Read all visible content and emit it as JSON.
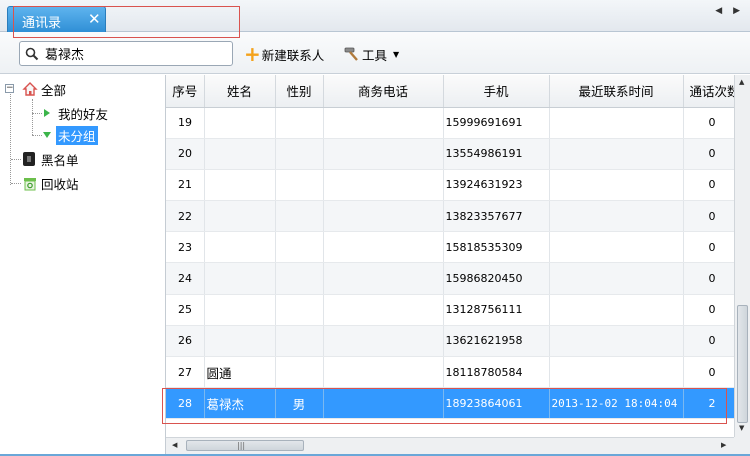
{
  "tab": {
    "title": "通讯录",
    "close": "✕"
  },
  "nav": {
    "arrows": "◀ ▶"
  },
  "toolbar": {
    "search_value": "葛禄杰",
    "new_contact_label": "新建联系人",
    "tools_label": "工具",
    "plus": "+",
    "caret": "▼"
  },
  "tree": {
    "root": "全部",
    "expander": "−",
    "children": [
      "我的好友",
      "未分组"
    ],
    "blacklist": "黑名单",
    "recycle": "回收站"
  },
  "table": {
    "headers": [
      "序号",
      "姓名",
      "性别",
      "商务电话",
      "手机",
      "最近联系时间",
      "通话次数"
    ],
    "rows": [
      [
        "19",
        "",
        "",
        "",
        "15999691691",
        "",
        "0"
      ],
      [
        "20",
        "",
        "",
        "",
        "13554986191",
        "",
        "0"
      ],
      [
        "21",
        "",
        "",
        "",
        "13924631923",
        "",
        "0"
      ],
      [
        "22",
        "",
        "",
        "",
        "13823357677",
        "",
        "0"
      ],
      [
        "23",
        "",
        "",
        "",
        "15818535309",
        "",
        "0"
      ],
      [
        "24",
        "",
        "",
        "",
        "15986820450",
        "",
        "0"
      ],
      [
        "25",
        "",
        "",
        "",
        "13128756111",
        "",
        "0"
      ],
      [
        "26",
        "",
        "",
        "",
        "13621621958",
        "",
        "0"
      ],
      [
        "27",
        "圆通",
        "",
        "",
        "18118780584",
        "",
        "0"
      ],
      [
        "28",
        "葛禄杰",
        "男",
        "",
        "18923864061",
        "2013-12-02 18:04:04",
        "2"
      ]
    ],
    "selected_row": 9
  },
  "scroll": {
    "up": "▲",
    "down": "▼",
    "left": "◀",
    "right": "▶",
    "grip": "|||"
  },
  "colors": {
    "accent": "#3399ff",
    "highlight_box": "#d9534f",
    "tab": "#2f8fd6"
  }
}
